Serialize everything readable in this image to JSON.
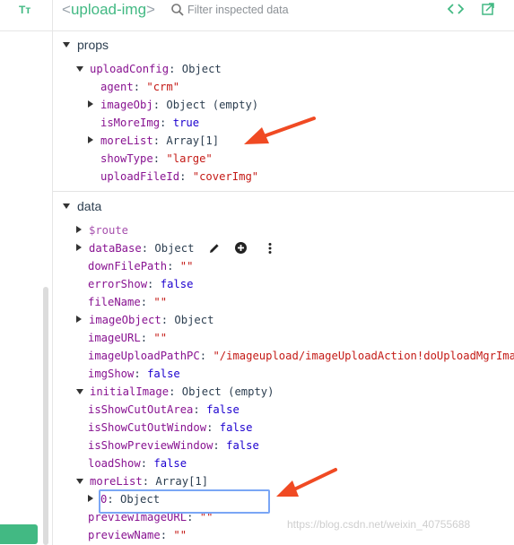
{
  "toolbar": {
    "font_toggle_label": "Tт"
  },
  "header": {
    "component_name": "upload-img",
    "open_bracket": "<",
    "close_bracket": ">",
    "filter_placeholder": "Filter inspected data"
  },
  "props": {
    "title": "props",
    "rows": {
      "uploadConfig": {
        "key": "uploadConfig",
        "value": "Object"
      },
      "agent": {
        "key": "agent",
        "value": "\"crm\""
      },
      "imageObj": {
        "key": "imageObj",
        "value": "Object (empty)"
      },
      "isMoreImg": {
        "key": "isMoreImg",
        "value": "true"
      },
      "moreList": {
        "key": "moreList",
        "value": "Array[1]"
      },
      "showType": {
        "key": "showType",
        "value": "\"large\""
      },
      "uploadFileId": {
        "key": "uploadFileId",
        "value": "\"coverImg\""
      }
    }
  },
  "data": {
    "title": "data",
    "rows": {
      "route": {
        "key": "$route"
      },
      "dataBase": {
        "key": "dataBase",
        "value": "Object"
      },
      "downFilePath": {
        "key": "downFilePath",
        "value": "\"\""
      },
      "errorShow": {
        "key": "errorShow",
        "value": "false"
      },
      "fileName": {
        "key": "fileName",
        "value": "\"\""
      },
      "imageObject": {
        "key": "imageObject",
        "value": "Object"
      },
      "imageURL": {
        "key": "imageURL",
        "value": "\"\""
      },
      "imageUploadPathPC": {
        "key": "imageUploadPathPC",
        "value": "\"/imageupload/imageUploadAction!doUploadMgrIma"
      },
      "imgShow": {
        "key": "imgShow",
        "value": "false"
      },
      "initialImage": {
        "key": "initialImage",
        "value": "Object (empty)"
      },
      "isShowCutOutArea": {
        "key": "isShowCutOutArea",
        "value": "false"
      },
      "isShowCutOutWindow": {
        "key": "isShowCutOutWindow",
        "value": "false"
      },
      "isShowPreviewWindow": {
        "key": "isShowPreviewWindow",
        "value": "false"
      },
      "loadShow": {
        "key": "loadShow",
        "value": "false"
      },
      "moreList": {
        "key": "moreList",
        "value": "Array[1]"
      },
      "item0": {
        "key": "0",
        "value": "Object"
      },
      "previewImageURL": {
        "key": "previewImageURL",
        "value": "\"\""
      },
      "previewName": {
        "key": "previewName",
        "value": "\"\""
      }
    }
  },
  "watermark": "https://blog.csdn.net/weixin_40755688",
  "colors": {
    "accent": "#42b983",
    "key": "#881391",
    "string": "#c41a16",
    "boolean": "#1c00cf",
    "annotation_arrow": "#f04a23",
    "highlight": "#7aa6f5"
  },
  "icons": [
    "font-toggle-icon",
    "search-icon",
    "code-icon",
    "open-in-editor-icon",
    "edit-pencil-icon",
    "add-circle-icon",
    "more-vertical-icon"
  ]
}
